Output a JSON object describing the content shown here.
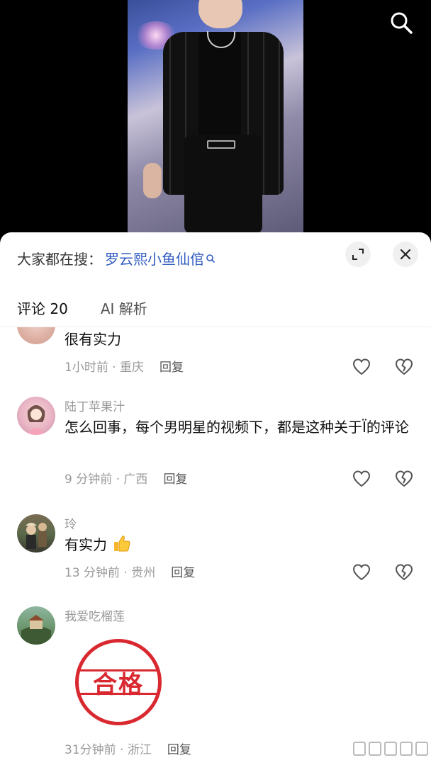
{
  "video": {
    "search_icon": "search-icon"
  },
  "sheet": {
    "hot_search_prefix": "大家都在搜：",
    "hot_search_query": "罗云熙小鱼仙倌",
    "expand_icon": "expand-icon",
    "close_icon": "close-icon"
  },
  "tabs": [
    {
      "label": "评论 20"
    },
    {
      "label": "AI 解析"
    }
  ],
  "comments": [
    {
      "username": "",
      "text": "很有实力",
      "time": "1小时前 · 重庆",
      "reply": "回复"
    },
    {
      "username": "陆丁苹果汁",
      "text": "怎么回事，每个男明星的视频下，都是这种关于Ï的评论",
      "time": "9 分钟前 · 广西",
      "reply": "回复"
    },
    {
      "username": "玲",
      "text": "有实力",
      "time": "13 分钟前 · 贵州",
      "reply": "回复"
    },
    {
      "username": "我爱吃榴莲",
      "stamp_text": "合格",
      "time": "31分钟前 · 浙江",
      "reply": "回复"
    }
  ],
  "colors": {
    "accent_link": "#2f5bbf",
    "stamp_red": "#d9282f",
    "meta_gray": "#9a9a9a"
  }
}
